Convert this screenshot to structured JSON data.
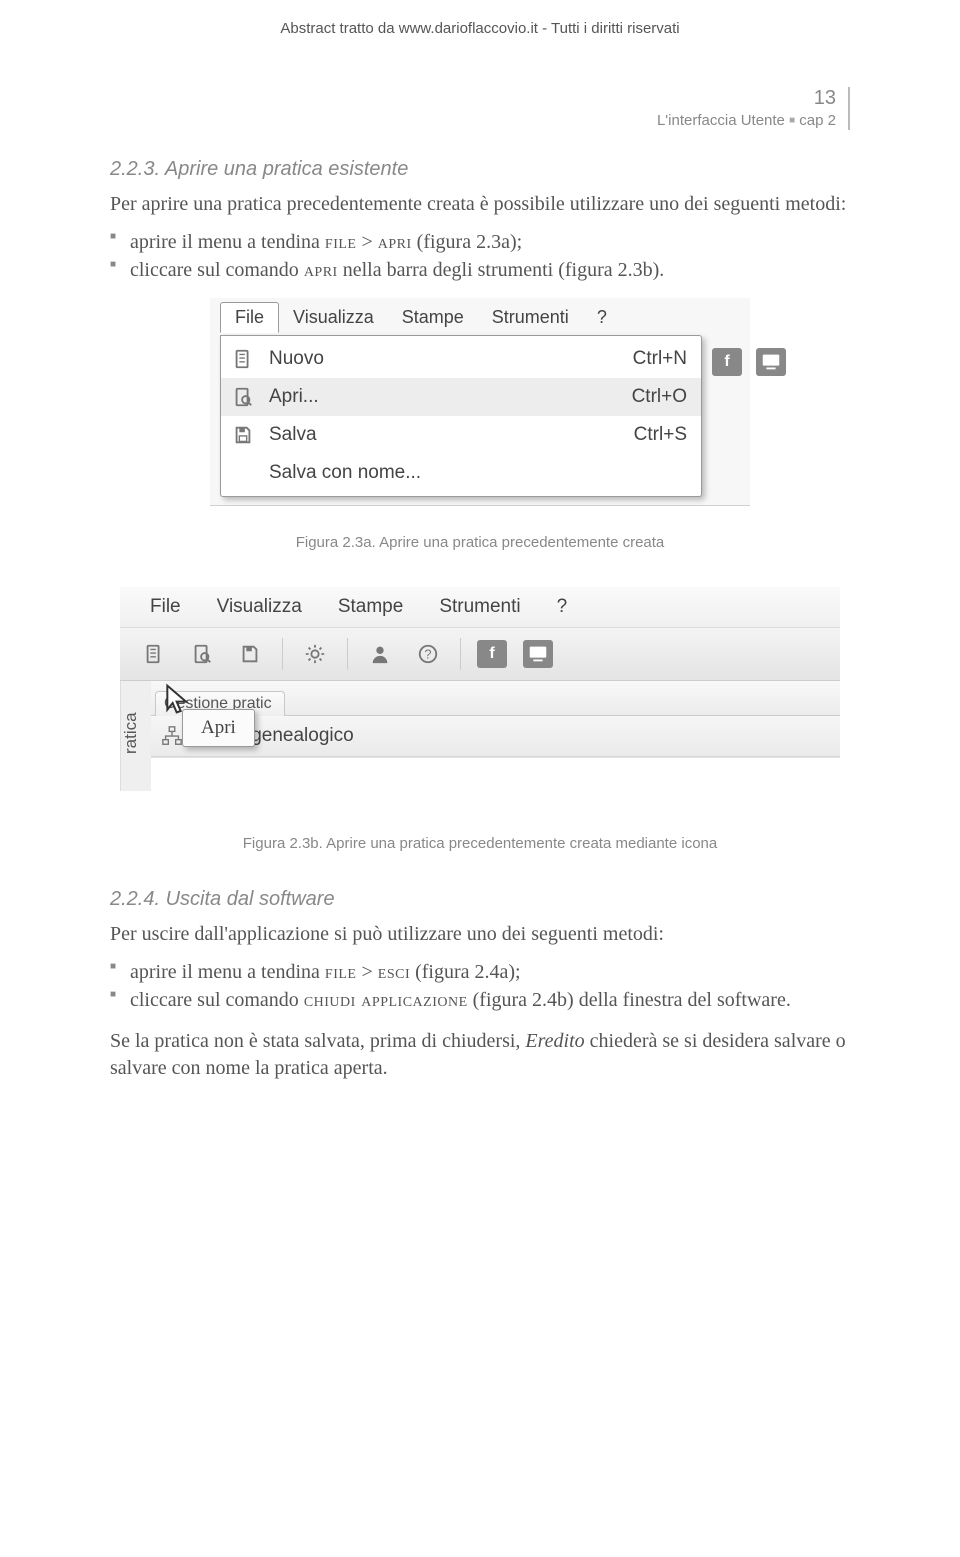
{
  "header": "Abstract tratto da www.darioflaccovio.it - Tutti i diritti riservati",
  "page_number": "13",
  "running_head": {
    "left": "L'interfaccia Utente",
    "right": "cap 2"
  },
  "s223": {
    "num": "2.2.3.",
    "title": "Aprire una pratica esistente",
    "lead": "Per aprire una pratica precedentemente creata è possibile utilizzare uno dei seguenti metodi:",
    "b1a": "aprire il menu a tendina ",
    "b1b": "file",
    "b1c": "  >  ",
    "b1d": "apri",
    "b1e": " (figura 2.3a);",
    "b2a": "cliccare sul comando ",
    "b2b": "apri",
    "b2c": " nella barra degli strumenti (figura 2.3b)."
  },
  "figA": {
    "menubar": [
      "File",
      "Visualizza",
      "Stampe",
      "Strumenti",
      "?"
    ],
    "rows": [
      {
        "label": "Nuovo",
        "shortcut": "Ctrl+N"
      },
      {
        "label": "Apri...",
        "shortcut": "Ctrl+O"
      },
      {
        "label": "Salva",
        "shortcut": "Ctrl+S"
      },
      {
        "label": "Salva con nome...",
        "shortcut": ""
      }
    ],
    "caption": "Figura 2.3a. Aprire una pratica precedentemente creata"
  },
  "figB": {
    "menubar": [
      "File",
      "Visualizza",
      "Stampe",
      "Strumenti",
      "?"
    ],
    "tab_label": "Gestione pratic",
    "subline_label": "Albero genealogico",
    "tooltip": "Apri",
    "sidetab": "ratica",
    "caption": "Figura 2.3b. Aprire una pratica precedentemente creata mediante icona"
  },
  "s224": {
    "num": "2.2.4.",
    "title": "Uscita dal software",
    "lead": "Per uscire dall'applicazione si può utilizzare uno dei seguenti metodi:",
    "b1a": "aprire il menu a tendina ",
    "b1b": "file",
    "b1c": " > ",
    "b1d": "esci",
    "b1e": " (figura 2.4a);",
    "b2a": "cliccare sul comando ",
    "b2b": "chiudi applicazione",
    "b2c": " (figura 2.4b) della finestra del software.",
    "closing_a": "Se la pratica non è stata salvata, prima di chiudersi, ",
    "closing_b": "Eredito",
    "closing_c": " chiederà se si desidera salvare o salvare con nome la pratica aperta."
  }
}
